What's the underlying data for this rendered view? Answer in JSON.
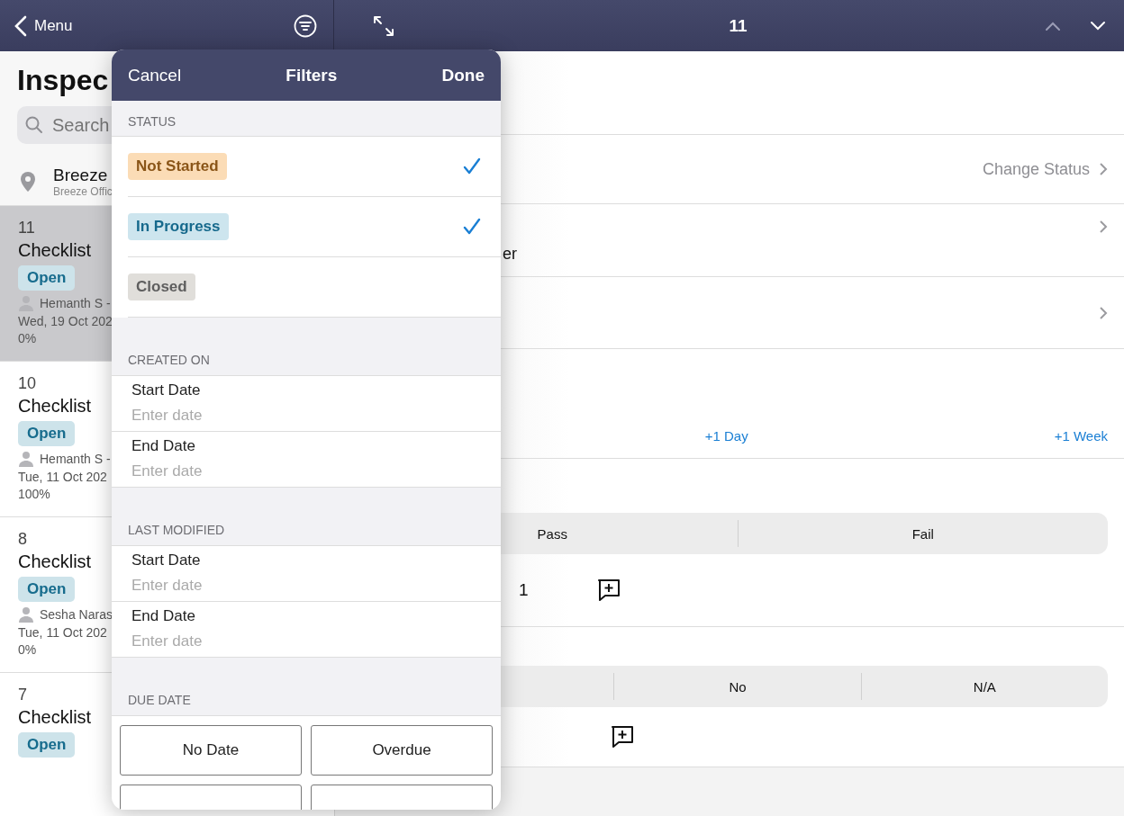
{
  "top_bar": {
    "back_label": "Menu",
    "title": "11"
  },
  "sidebar": {
    "title": "Inspec",
    "search_placeholder": "Search",
    "location": {
      "name": "Breeze",
      "subtitle": "Breeze Offic"
    },
    "items": [
      {
        "number": "11",
        "name": "Checklist",
        "status": "Open",
        "assignee": "Hemanth S -",
        "date": "Wed, 19 Oct 202",
        "progress": "0%",
        "selected": true
      },
      {
        "number": "10",
        "name": "Checklist",
        "status": "Open",
        "assignee": "Hemanth S -",
        "date": "Tue, 11 Oct 202",
        "progress": "100%",
        "selected": false
      },
      {
        "number": "8",
        "name": "Checklist",
        "status": "Open",
        "assignee": "Sesha Naras",
        "date": "Tue, 11 Oct 202",
        "progress": "0%",
        "selected": false
      },
      {
        "number": "7",
        "name": "Checklist",
        "status": "Open",
        "selected": false
      }
    ]
  },
  "detail": {
    "status_action": "Change Status",
    "fragment": "er",
    "date_buttons": [
      "+1 Day",
      "+1 Week"
    ],
    "questions": [
      {
        "segments": [
          {
            "kind": "text",
            "label": "Pass"
          },
          {
            "kind": "text",
            "label": "Fail"
          }
        ],
        "value": "1"
      },
      {
        "segments": [
          {
            "kind": "blank"
          },
          {
            "kind": "text",
            "label": "No"
          },
          {
            "kind": "text",
            "label": "N/A"
          }
        ]
      }
    ]
  },
  "filters": {
    "cancel": "Cancel",
    "title": "Filters",
    "done": "Done",
    "sections": [
      {
        "kind": "status",
        "heading": "STATUS",
        "options": [
          {
            "label": "Not Started",
            "color": "#fbdcb6",
            "checked": true
          },
          {
            "label": "In Progress",
            "color": "#cde5ee",
            "checked": true
          },
          {
            "label": "Closed",
            "color": "#e0deda",
            "checked": false
          }
        ]
      },
      {
        "kind": "dates",
        "heading": "CREATED ON",
        "fields": [
          {
            "label": "Start Date",
            "placeholder": "Enter date"
          },
          {
            "label": "End Date",
            "placeholder": "Enter date"
          }
        ]
      },
      {
        "kind": "dates",
        "heading": "LAST MODIFIED",
        "fields": [
          {
            "label": "Start Date",
            "placeholder": "Enter date"
          },
          {
            "label": "End Date",
            "placeholder": "Enter date"
          }
        ]
      },
      {
        "kind": "buttons",
        "heading": "DUE DATE",
        "buttons": [
          {
            "kind": "text",
            "label": "No Date"
          },
          {
            "kind": "text",
            "label": "Overdue"
          },
          {
            "kind": "blank"
          },
          {
            "kind": "blank"
          }
        ]
      }
    ]
  }
}
